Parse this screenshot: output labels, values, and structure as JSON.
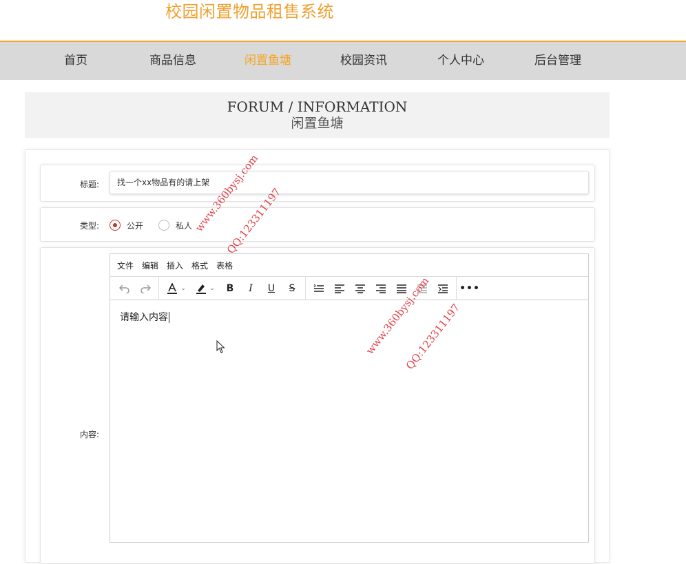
{
  "site": {
    "title": "校园闲置物品租售系统"
  },
  "nav": {
    "items": [
      {
        "label": "首页"
      },
      {
        "label": "商品信息"
      },
      {
        "label": "闲置鱼塘"
      },
      {
        "label": "校园资讯"
      },
      {
        "label": "个人中心"
      },
      {
        "label": "后台管理"
      }
    ],
    "active_index": 2
  },
  "banner": {
    "en": "FORUM / INFORMATION",
    "cn": "闲置鱼塘"
  },
  "form": {
    "title_label": "标题:",
    "title_value": "找一个xx物品有的请上架",
    "type_label": "类型:",
    "type_options": [
      {
        "label": "公开",
        "checked": true
      },
      {
        "label": "私人",
        "checked": false
      }
    ],
    "content_label": "内容:"
  },
  "editor": {
    "menu": [
      "文件",
      "编辑",
      "插入",
      "格式",
      "表格"
    ],
    "placeholder": "请输入内容",
    "toolbar_icons": [
      "undo-icon",
      "redo-icon",
      "font-color-icon",
      "highlight-icon",
      "bold-icon",
      "italic-icon",
      "underline-icon",
      "strikethrough-icon",
      "line-height-icon",
      "align-left-icon",
      "align-center-icon",
      "align-right-icon",
      "justify-icon",
      "outdent-icon",
      "indent-icon",
      "more-icon"
    ]
  },
  "watermarks": {
    "site": "www.360bysj.com",
    "qq": "QQ:123311197"
  },
  "colors": {
    "accent": "#f5a623",
    "radio": "#c0392b",
    "watermark": "#dc1e28"
  }
}
